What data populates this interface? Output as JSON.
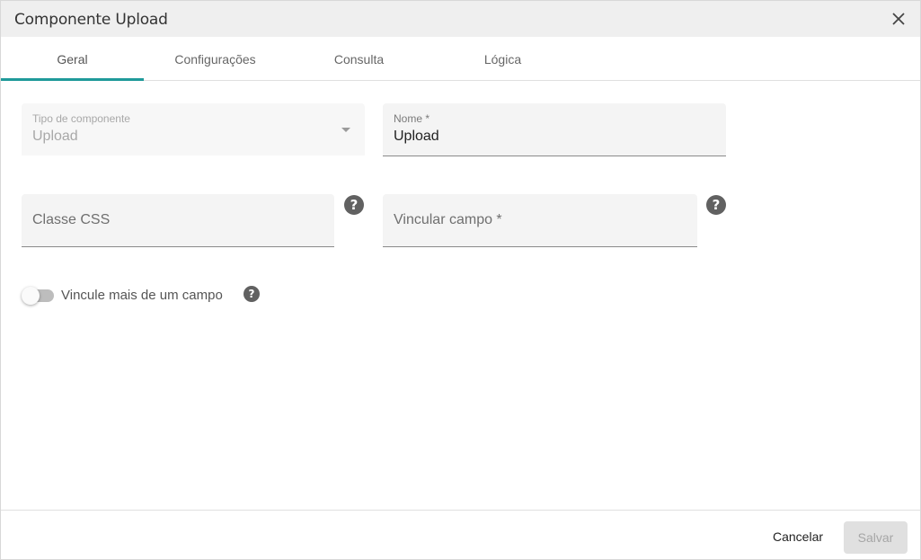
{
  "dialog": {
    "title": "Componente Upload"
  },
  "tabs": [
    {
      "label": "Geral",
      "active": true
    },
    {
      "label": "Configurações",
      "active": false
    },
    {
      "label": "Consulta",
      "active": false
    },
    {
      "label": "Lógica",
      "active": false
    }
  ],
  "form": {
    "component_type": {
      "label": "Tipo de componente",
      "value": "Upload",
      "disabled": true
    },
    "name": {
      "label": "Nome *",
      "value": "Upload"
    },
    "css_class": {
      "placeholder": "Classe CSS",
      "value": ""
    },
    "bind_field": {
      "placeholder": "Vincular campo *",
      "value": ""
    },
    "multi_bind_toggle": {
      "label": "Vincule mais de um campo",
      "checked": false
    }
  },
  "help_icon_glyph": "?",
  "footer": {
    "cancel_label": "Cancelar",
    "save_label": "Salvar",
    "save_disabled": true
  },
  "colors": {
    "accent": "#1f9a9a",
    "header_bg": "#efefef",
    "field_bg": "#f4f4f4"
  },
  "icons": [
    "close-icon",
    "chevron-down-icon",
    "help-icon"
  ]
}
